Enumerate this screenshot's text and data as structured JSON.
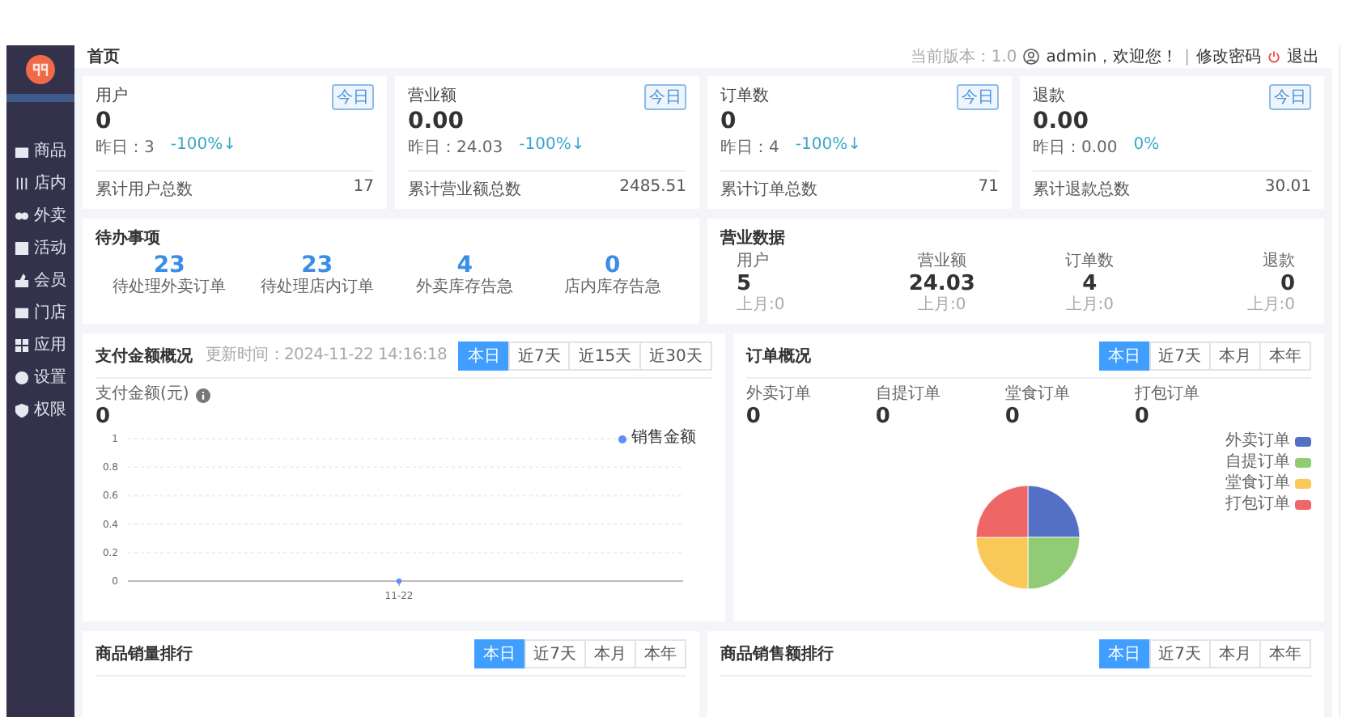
{
  "sidebar": {
    "items": [
      {
        "label": "商品",
        "selected": false
      },
      {
        "label": "店内",
        "selected": false
      },
      {
        "label": "外卖",
        "selected": false
      },
      {
        "label": "活动",
        "selected": false
      },
      {
        "label": "会员",
        "selected": false
      },
      {
        "label": "门店",
        "selected": false
      },
      {
        "label": "应用",
        "selected": false
      },
      {
        "label": "设置",
        "selected": false
      },
      {
        "label": "权限",
        "selected": false
      }
    ]
  },
  "header": {
    "title": "首页",
    "version": "当前版本：1.0",
    "user": "admin，欢迎您！",
    "separator": "|",
    "change_password": "修改密码",
    "logout": "退出"
  },
  "stat_cards": [
    {
      "label": "用户",
      "badge": "今日",
      "value": "0",
      "yesterday": "昨日：3",
      "change": "-100%↓",
      "total_label": "累计用户总数",
      "total": "17"
    },
    {
      "label": "营业额",
      "badge": "今日",
      "value": "0.00",
      "yesterday": "昨日：24.03",
      "change": "-100%↓",
      "total_label": "累计营业额总数",
      "total": "2485.51"
    },
    {
      "label": "订单数",
      "badge": "今日",
      "value": "0",
      "yesterday": "昨日：4",
      "change": "-100%↓",
      "total_label": "累计订单总数",
      "total": "71"
    },
    {
      "label": "退款",
      "badge": "今日",
      "value": "0.00",
      "yesterday": "昨日：0.00",
      "change": "0%",
      "total_label": "累计退款总数",
      "total": "30.01"
    }
  ],
  "todo": {
    "title": "待办事项",
    "items": [
      {
        "value": "23",
        "label": "待处理外卖订单"
      },
      {
        "value": "23",
        "label": "待处理店内订单"
      },
      {
        "value": "4",
        "label": "外卖库存告急"
      },
      {
        "value": "0",
        "label": "店内库存告急"
      }
    ]
  },
  "business": {
    "title": "营业数据",
    "items": [
      {
        "label": "用户",
        "value": "5",
        "last_month": "上月:0"
      },
      {
        "label": "营业额",
        "value": "24.03",
        "last_month": "上月:0"
      },
      {
        "label": "订单数",
        "value": "4",
        "last_month": "上月:0"
      },
      {
        "label": "退款",
        "value": "0",
        "last_month": "上月:0"
      }
    ]
  },
  "payment": {
    "title": "支付金额概况",
    "updated": "更新时间：2024-11-22 14:16:18",
    "tabs": [
      {
        "label": "本日",
        "selected": true
      },
      {
        "label": "近7天",
        "selected": false
      },
      {
        "label": "近15天",
        "selected": false
      },
      {
        "label": "近30天",
        "selected": false
      }
    ],
    "metric_label": "支付金额(元)",
    "metric_value": "0",
    "chart_data": {
      "type": "line",
      "grid": true,
      "x": [
        "11-22"
      ],
      "ylim": [
        0,
        1
      ],
      "yticks": [
        0,
        0.2,
        0.4,
        0.6,
        0.8,
        1
      ],
      "series": [
        {
          "name": "销售金额",
          "color": "#5b8ff9",
          "marker": true,
          "values": [
            0
          ]
        }
      ]
    }
  },
  "orders": {
    "title": "订单概况",
    "tabs": [
      {
        "label": "本日",
        "selected": true
      },
      {
        "label": "近7天",
        "selected": false
      },
      {
        "label": "本月",
        "selected": false
      },
      {
        "label": "本年",
        "selected": false
      }
    ],
    "metrics": [
      {
        "label": "外卖订单",
        "value": "0"
      },
      {
        "label": "自提订单",
        "value": "0"
      },
      {
        "label": "堂食订单",
        "value": "0"
      },
      {
        "label": "打包订单",
        "value": "0"
      }
    ],
    "legend": [
      {
        "label": "外卖订单",
        "color": "#5470c6"
      },
      {
        "label": "自提订单",
        "color": "#91cc75"
      },
      {
        "label": "堂食订单",
        "color": "#fac858"
      },
      {
        "label": "打包订单",
        "color": "#ee6666"
      }
    ]
  },
  "rankings": [
    {
      "title": "商品销量排行",
      "tabs": [
        {
          "label": "本日",
          "selected": true
        },
        {
          "label": "近7天",
          "selected": false
        },
        {
          "label": "本月",
          "selected": false
        },
        {
          "label": "本年",
          "selected": false
        }
      ]
    },
    {
      "title": "商品销售额排行",
      "tabs": [
        {
          "label": "本日",
          "selected": true
        },
        {
          "label": "近7天",
          "selected": false
        },
        {
          "label": "本月",
          "selected": false
        },
        {
          "label": "本年",
          "selected": false
        }
      ]
    }
  ]
}
